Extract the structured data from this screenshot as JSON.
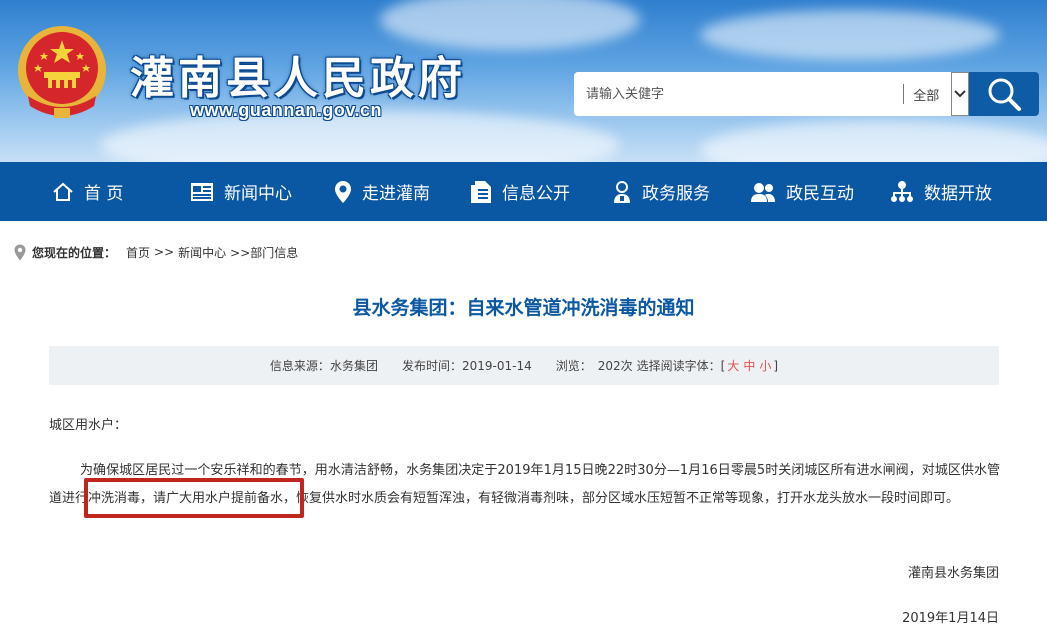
{
  "header": {
    "site_title": "灌南县人民政府",
    "site_url": "www.guannan.gov.cn",
    "emblem_icon": "national-emblem-icon"
  },
  "search": {
    "placeholder": "请输入关健字",
    "scope": "全部",
    "dropdown_icon": "chevron-down-icon",
    "button_icon": "search-icon"
  },
  "nav": {
    "items": [
      {
        "label": "首 页",
        "icon": "home-icon"
      },
      {
        "label": "新闻中心",
        "icon": "news-icon"
      },
      {
        "label": "走进灌南",
        "icon": "location-pin-icon"
      },
      {
        "label": "信息公开",
        "icon": "document-icon"
      },
      {
        "label": "政务服务",
        "icon": "user-service-icon"
      },
      {
        "label": "政民互动",
        "icon": "users-icon"
      },
      {
        "label": "数据开放",
        "icon": "data-tree-icon"
      }
    ]
  },
  "breadcrumb": {
    "label": "您现在的位置：",
    "items": [
      "首页",
      ">>",
      "新闻中心",
      ">>部门信息"
    ]
  },
  "article": {
    "title": "县水务集团：自来水管道冲洗消毒的通知",
    "meta": {
      "source_label": "信息来源：",
      "source": "水务集团",
      "date_label": "发布时间：",
      "date": "2019-01-14",
      "views_label": "浏览：",
      "views": "202次",
      "font_label": "选择阅读字体：",
      "font_open": "[",
      "font_large": "大",
      "font_medium": "中",
      "font_small": "小",
      "font_close": "]"
    },
    "greeting": "城区用水户：",
    "paragraph": "为确保城区居民过一个安乐祥和的春节，用水清洁舒畅，水务集团决定于2019年1月15日晚22时30分—1月16日零晨5时关闭城区所有进水闸阀，对城区供水管道进行冲洗消毒，请广大用水户提前备水，恢复供水时水质会有短暂浑浊，有轻微消毒剂味，部分区域水压短暂不正常等现象，打开水龙头放水一段时间即可。",
    "signature": "灌南县水务集团",
    "date": "2019年1月14日"
  },
  "colors": {
    "nav_bg": "#0a57a3",
    "title_blue": "#0d58a3",
    "highlight_red": "#c0251e"
  }
}
